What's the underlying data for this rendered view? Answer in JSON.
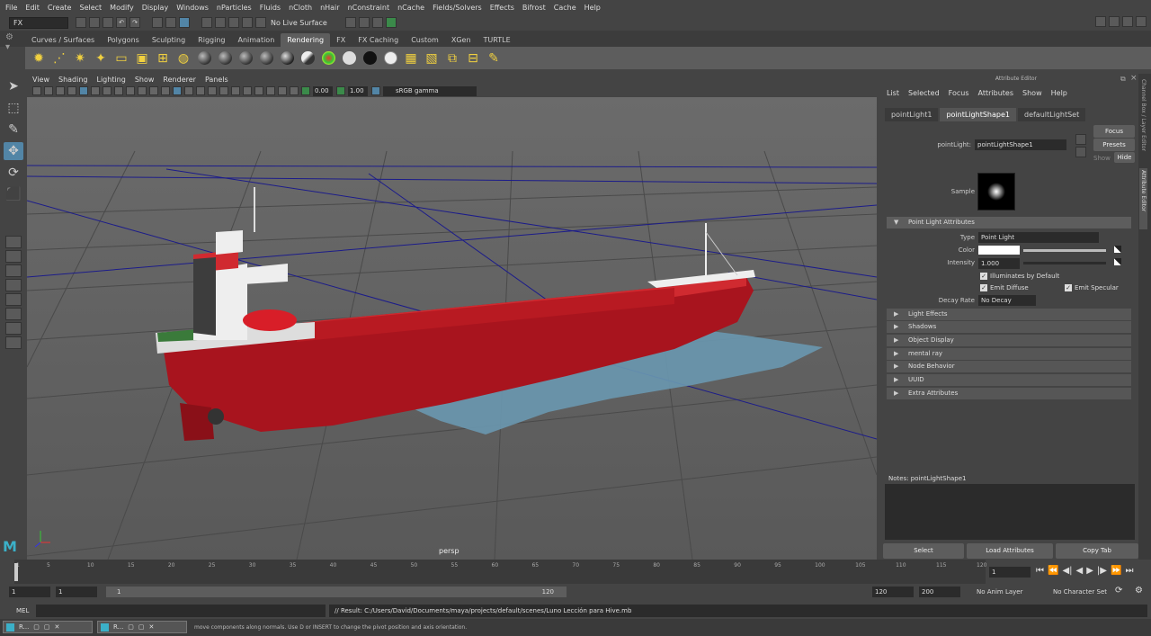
{
  "menubar": [
    "File",
    "Edit",
    "Create",
    "Select",
    "Modify",
    "Display",
    "Windows",
    "nParticles",
    "Fluids",
    "nCloth",
    "nHair",
    "nConstraint",
    "nCache",
    "Fields/Solvers",
    "Effects",
    "Bifrost",
    "Cache",
    "Help"
  ],
  "status": {
    "mode": "FX",
    "live_surface": "No Live Surface"
  },
  "shelf_tabs": [
    "Curves / Surfaces",
    "Polygons",
    "Sculpting",
    "Rigging",
    "Animation",
    "Rendering",
    "FX",
    "FX Caching",
    "Custom",
    "XGen",
    "TURTLE"
  ],
  "shelf_active": "Rendering",
  "viewport": {
    "menu": [
      "View",
      "Shading",
      "Lighting",
      "Show",
      "Renderer",
      "Panels"
    ],
    "near": "0.00",
    "far": "1.00",
    "color_space": "sRGB gamma",
    "camera": "persp"
  },
  "attr_editor": {
    "title": "Attribute Editor",
    "menu": [
      "List",
      "Selected",
      "Focus",
      "Attributes",
      "Show",
      "Help"
    ],
    "tabs": [
      "pointLight1",
      "pointLightShape1",
      "defaultLightSet"
    ],
    "node_label": "pointLight:",
    "node_name": "pointLightShape1",
    "focus": "Focus",
    "presets": "Presets",
    "show": "Show",
    "hide": "Hide",
    "sample_label": "Sample",
    "section_open": "Point Light Attributes",
    "type_label": "Type",
    "type_value": "Point Light",
    "color_label": "Color",
    "intensity_label": "Intensity",
    "intensity_value": "1.000",
    "illum": "Illuminates by Default",
    "diffuse": "Emit Diffuse",
    "specular": "Emit Specular",
    "decay_label": "Decay Rate",
    "decay_value": "No Decay",
    "sections": [
      "Light Effects",
      "Shadows",
      "Object Display",
      "mental ray",
      "Node Behavior",
      "UUID",
      "Extra Attributes"
    ],
    "notes": "Notes:  pointLightShape1",
    "select": "Select",
    "load": "Load Attributes",
    "copy": "Copy Tab"
  },
  "side_tabs": {
    "channel": "Channel Box / Layer Editor",
    "attr": "Attribute Editor"
  },
  "time": {
    "ticks": [
      "1",
      "5",
      "10",
      "15",
      "20",
      "25",
      "30",
      "35",
      "40",
      "45",
      "50",
      "55",
      "60",
      "65",
      "70",
      "75",
      "80",
      "85",
      "90",
      "95",
      "100",
      "105",
      "110",
      "115",
      "120"
    ],
    "current": "1",
    "start": "1",
    "inner_start": "1",
    "range_start_label": "1",
    "range_end_label": "120",
    "end": "120",
    "max": "200",
    "anim_layer": "No Anim Layer",
    "char_set": "No Character Set"
  },
  "cmd": {
    "lang": "MEL",
    "result": "// Result: C:/Users/David/Documents/maya/projects/default/scenes/Luno Lección para Hive.mb"
  },
  "help": "move components along normals. Use D or INSERT to change the pivot position and axis orientation.",
  "taskbar": [
    "R...",
    "R..."
  ]
}
